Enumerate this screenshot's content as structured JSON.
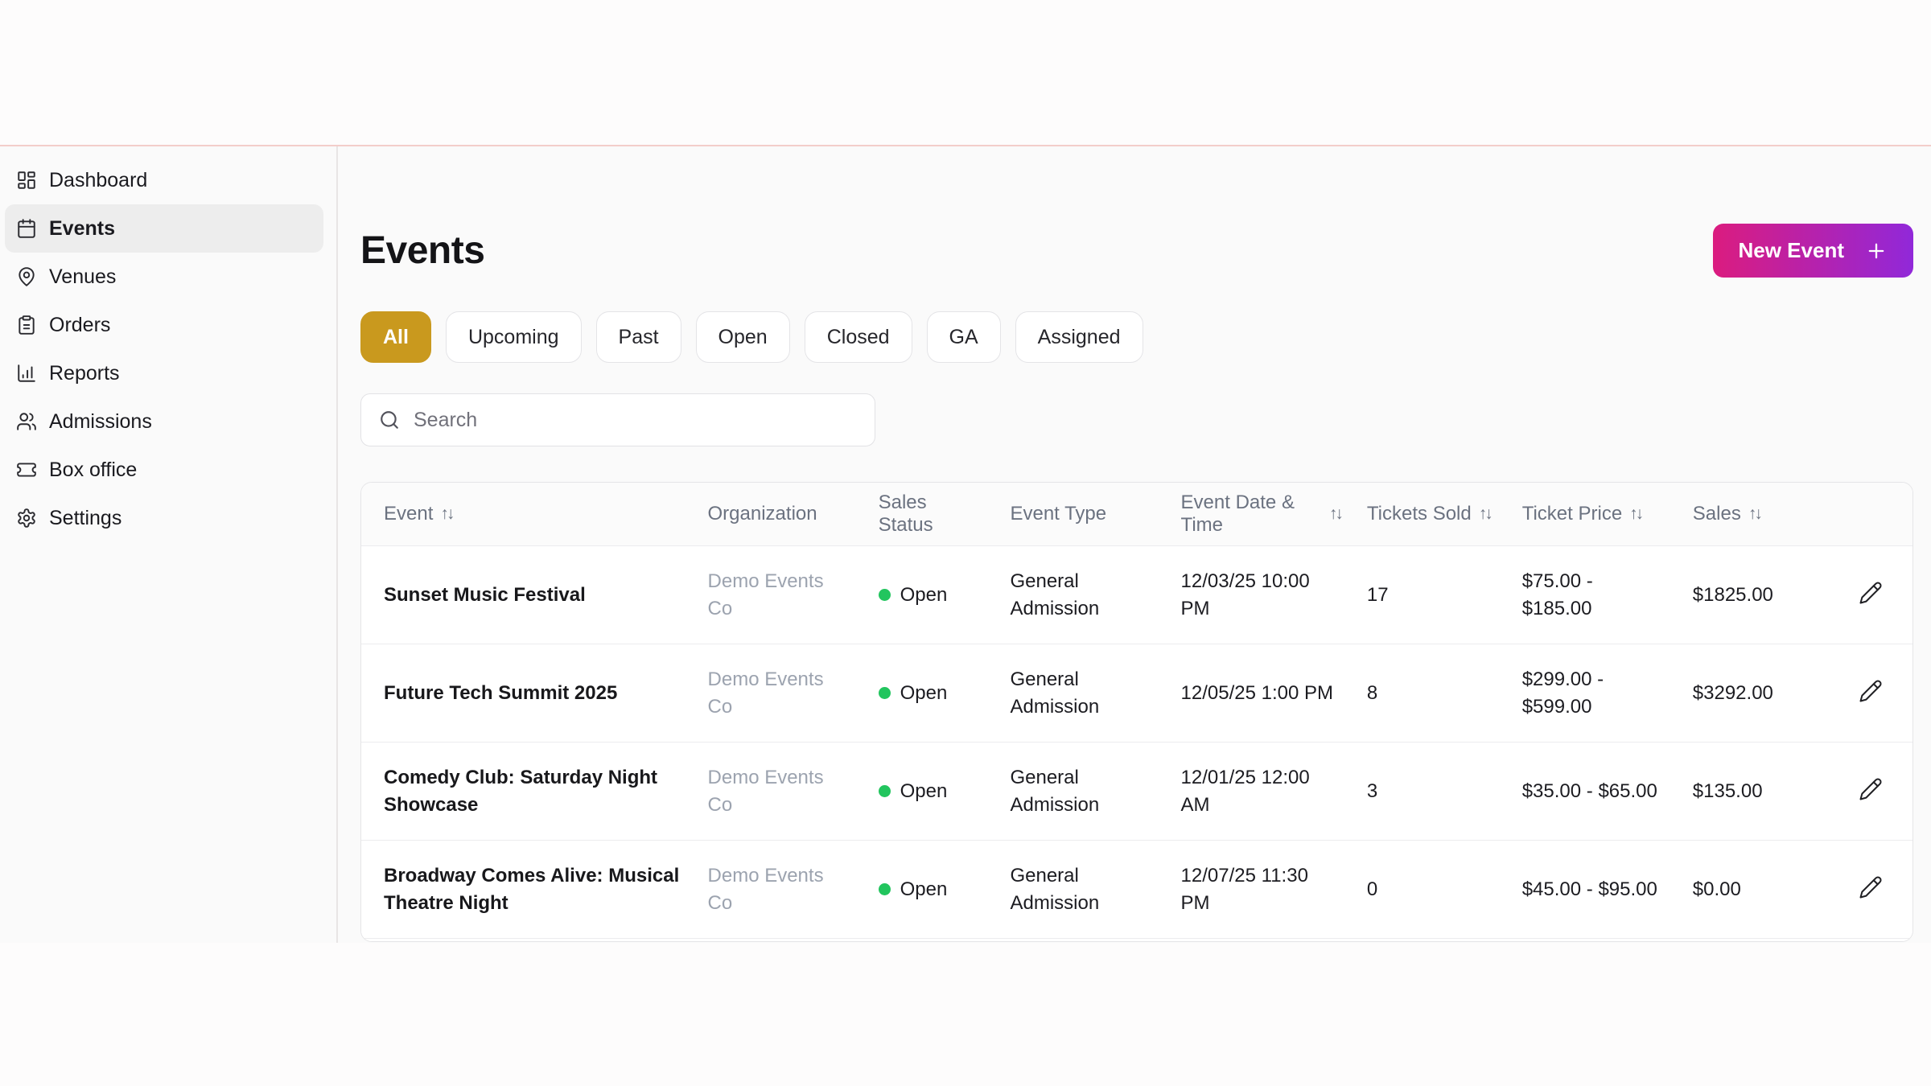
{
  "sidebar": {
    "items": [
      {
        "label": "Dashboard",
        "icon": "dashboard",
        "active": false
      },
      {
        "label": "Events",
        "icon": "calendar",
        "active": true
      },
      {
        "label": "Venues",
        "icon": "map-pin",
        "active": false
      },
      {
        "label": "Orders",
        "icon": "clipboard",
        "active": false
      },
      {
        "label": "Reports",
        "icon": "bar-chart",
        "active": false
      },
      {
        "label": "Admissions",
        "icon": "users",
        "active": false
      },
      {
        "label": "Box office",
        "icon": "ticket",
        "active": false
      },
      {
        "label": "Settings",
        "icon": "gear",
        "active": false
      }
    ]
  },
  "header": {
    "title": "Events",
    "new_event_button": {
      "label": "New Event",
      "icon": "plus"
    }
  },
  "filters": [
    {
      "label": "All",
      "active": true
    },
    {
      "label": "Upcoming",
      "active": false
    },
    {
      "label": "Past",
      "active": false
    },
    {
      "label": "Open",
      "active": false
    },
    {
      "label": "Closed",
      "active": false
    },
    {
      "label": "GA",
      "active": false
    },
    {
      "label": "Assigned",
      "active": false
    }
  ],
  "search": {
    "placeholder": "Search",
    "value": ""
  },
  "table": {
    "sort_glyph": "↑↓",
    "columns": [
      {
        "key": "event",
        "label": "Event",
        "sortable": true
      },
      {
        "key": "organization",
        "label": "Organization",
        "sortable": false
      },
      {
        "key": "sales_status",
        "label": "Sales Status",
        "sortable": false
      },
      {
        "key": "event_type",
        "label": "Event Type",
        "sortable": false
      },
      {
        "key": "date_time",
        "label": "Event Date & Time",
        "sortable": true
      },
      {
        "key": "tickets_sold",
        "label": "Tickets Sold",
        "sortable": true
      },
      {
        "key": "ticket_price",
        "label": "Ticket Price",
        "sortable": true
      },
      {
        "key": "sales",
        "label": "Sales",
        "sortable": true
      },
      {
        "key": "actions",
        "label": "",
        "sortable": false
      }
    ],
    "rows": [
      {
        "event": "Sunset Music Festival",
        "organization": "Demo Events Co",
        "sales_status": "Open",
        "event_type": "General Admission",
        "date_time": "12/03/25 10:00 PM",
        "tickets_sold": "17",
        "ticket_price": "$75.00 - $185.00",
        "sales": "$1825.00"
      },
      {
        "event": "Future Tech Summit 2025",
        "organization": "Demo Events Co",
        "sales_status": "Open",
        "event_type": "General Admission",
        "date_time": "12/05/25 1:00 PM",
        "tickets_sold": "8",
        "ticket_price": "$299.00 - $599.00",
        "sales": "$3292.00"
      },
      {
        "event": "Comedy Club: Saturday Night Showcase",
        "organization": "Demo Events Co",
        "sales_status": "Open",
        "event_type": "General Admission",
        "date_time": "12/01/25 12:00 AM",
        "tickets_sold": "3",
        "ticket_price": "$35.00 - $65.00",
        "sales": "$135.00"
      },
      {
        "event": "Broadway Comes Alive: Musical Theatre Night",
        "organization": "Demo Events Co",
        "sales_status": "Open",
        "event_type": "General Admission",
        "date_time": "12/07/25 11:30 PM",
        "tickets_sold": "0",
        "ticket_price": "$45.00 - $95.00",
        "sales": "$0.00"
      }
    ]
  },
  "colors": {
    "active_filter_bg": "#C9991E",
    "new_event_gradient_start": "#DB1C7F",
    "new_event_gradient_end": "#9128D9",
    "status_open_dot": "#22C55E",
    "top_divider": "#F3CDCA"
  }
}
